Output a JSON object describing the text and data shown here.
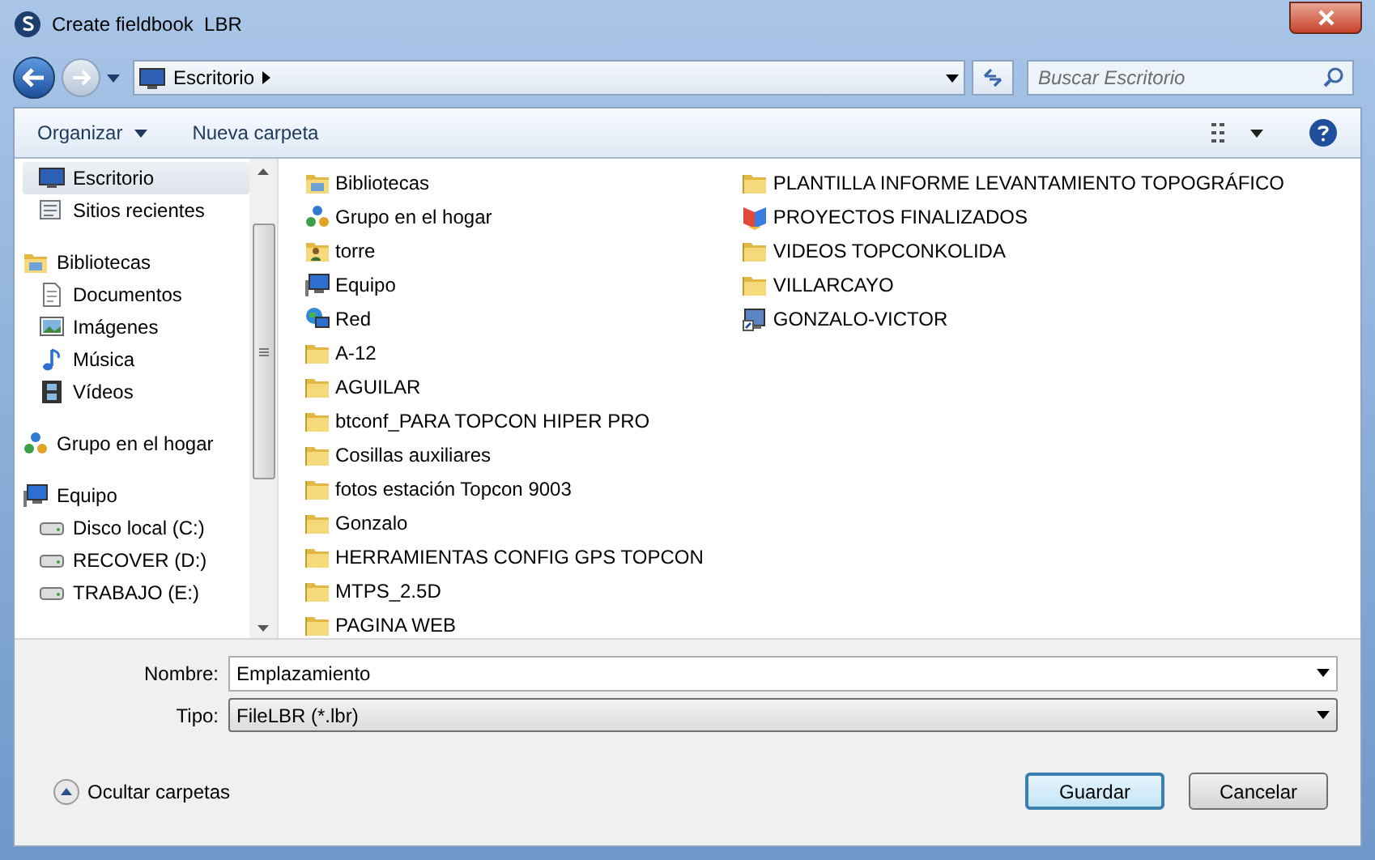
{
  "window": {
    "title": "Create fieldbook  LBR"
  },
  "address": {
    "path": "Escritorio"
  },
  "search": {
    "placeholder": "Buscar Escritorio"
  },
  "toolbar": {
    "buttons": [
      {
        "label": "Organizar",
        "dropdown": true
      },
      {
        "label": "Nueva carpeta",
        "dropdown": false
      }
    ]
  },
  "nav": [
    {
      "kind": "favorites",
      "items": [
        {
          "label": "Escritorio",
          "kind": "desktop",
          "selected": true
        },
        {
          "label": "Sitios recientes",
          "kind": "recent",
          "selected": false
        }
      ]
    },
    {
      "kind": "tree",
      "items": [
        {
          "label": "Bibliotecas",
          "kind": "library",
          "selected": false,
          "children": [
            {
              "label": "Documentos",
              "kind": "document",
              "selected": false
            },
            {
              "label": "Imágenes",
              "kind": "image",
              "selected": false
            },
            {
              "label": "Música",
              "kind": "music",
              "selected": false
            },
            {
              "label": "Vídeos",
              "kind": "video",
              "selected": false
            }
          ]
        }
      ]
    },
    {
      "kind": "tree",
      "items": [
        {
          "label": "Grupo en el hogar",
          "kind": "homegroup",
          "selected": false
        }
      ]
    },
    {
      "kind": "tree",
      "items": [
        {
          "label": "Equipo",
          "kind": "computer",
          "selected": false,
          "children": [
            {
              "label": "Disco local (C:)",
              "kind": "drive",
              "selected": false
            },
            {
              "label": "RECOVER (D:)",
              "kind": "drive",
              "selected": false
            },
            {
              "label": "TRABAJO (E:)",
              "kind": "drive",
              "selected": false
            }
          ]
        }
      ]
    }
  ],
  "files": [
    {
      "name": "Bibliotecas",
      "kind": "library"
    },
    {
      "name": "Grupo en el hogar",
      "kind": "homegroup"
    },
    {
      "name": "torre",
      "kind": "user-folder"
    },
    {
      "name": "Equipo",
      "kind": "computer"
    },
    {
      "name": "Red",
      "kind": "network"
    },
    {
      "name": "A-12",
      "kind": "folder"
    },
    {
      "name": "AGUILAR",
      "kind": "folder"
    },
    {
      "name": "btconf_PARA TOPCON HIPER PRO",
      "kind": "folder"
    },
    {
      "name": "Cosillas auxiliares",
      "kind": "folder"
    },
    {
      "name": "fotos estación Topcon 9003",
      "kind": "folder"
    },
    {
      "name": "Gonzalo",
      "kind": "folder"
    },
    {
      "name": "HERRAMIENTAS CONFIG GPS TOPCON",
      "kind": "folder"
    },
    {
      "name": "MTPS_2.5D",
      "kind": "folder"
    },
    {
      "name": "PAGINA WEB",
      "kind": "folder"
    },
    {
      "name": "PLANTILLA INFORME LEVANTAMIENTO TOPOGRÁFICO",
      "kind": "folder"
    },
    {
      "name": "PROYECTOS FINALIZADOS",
      "kind": "app-file"
    },
    {
      "name": "VIDEOS TOPCONKOLIDA",
      "kind": "folder"
    },
    {
      "name": "VILLARCAYO",
      "kind": "folder"
    },
    {
      "name": "GONZALO-VICTOR",
      "kind": "shortcut"
    }
  ],
  "form": {
    "name_label": "Nombre:",
    "name_value": "Emplazamiento",
    "type_label": "Tipo:",
    "type_value": "FileLBR (*.lbr)"
  },
  "hide_folders": "Ocultar carpetas",
  "buttons": [
    {
      "label": "Guardar",
      "default": true
    },
    {
      "label": "Cancelar",
      "default": false
    }
  ]
}
